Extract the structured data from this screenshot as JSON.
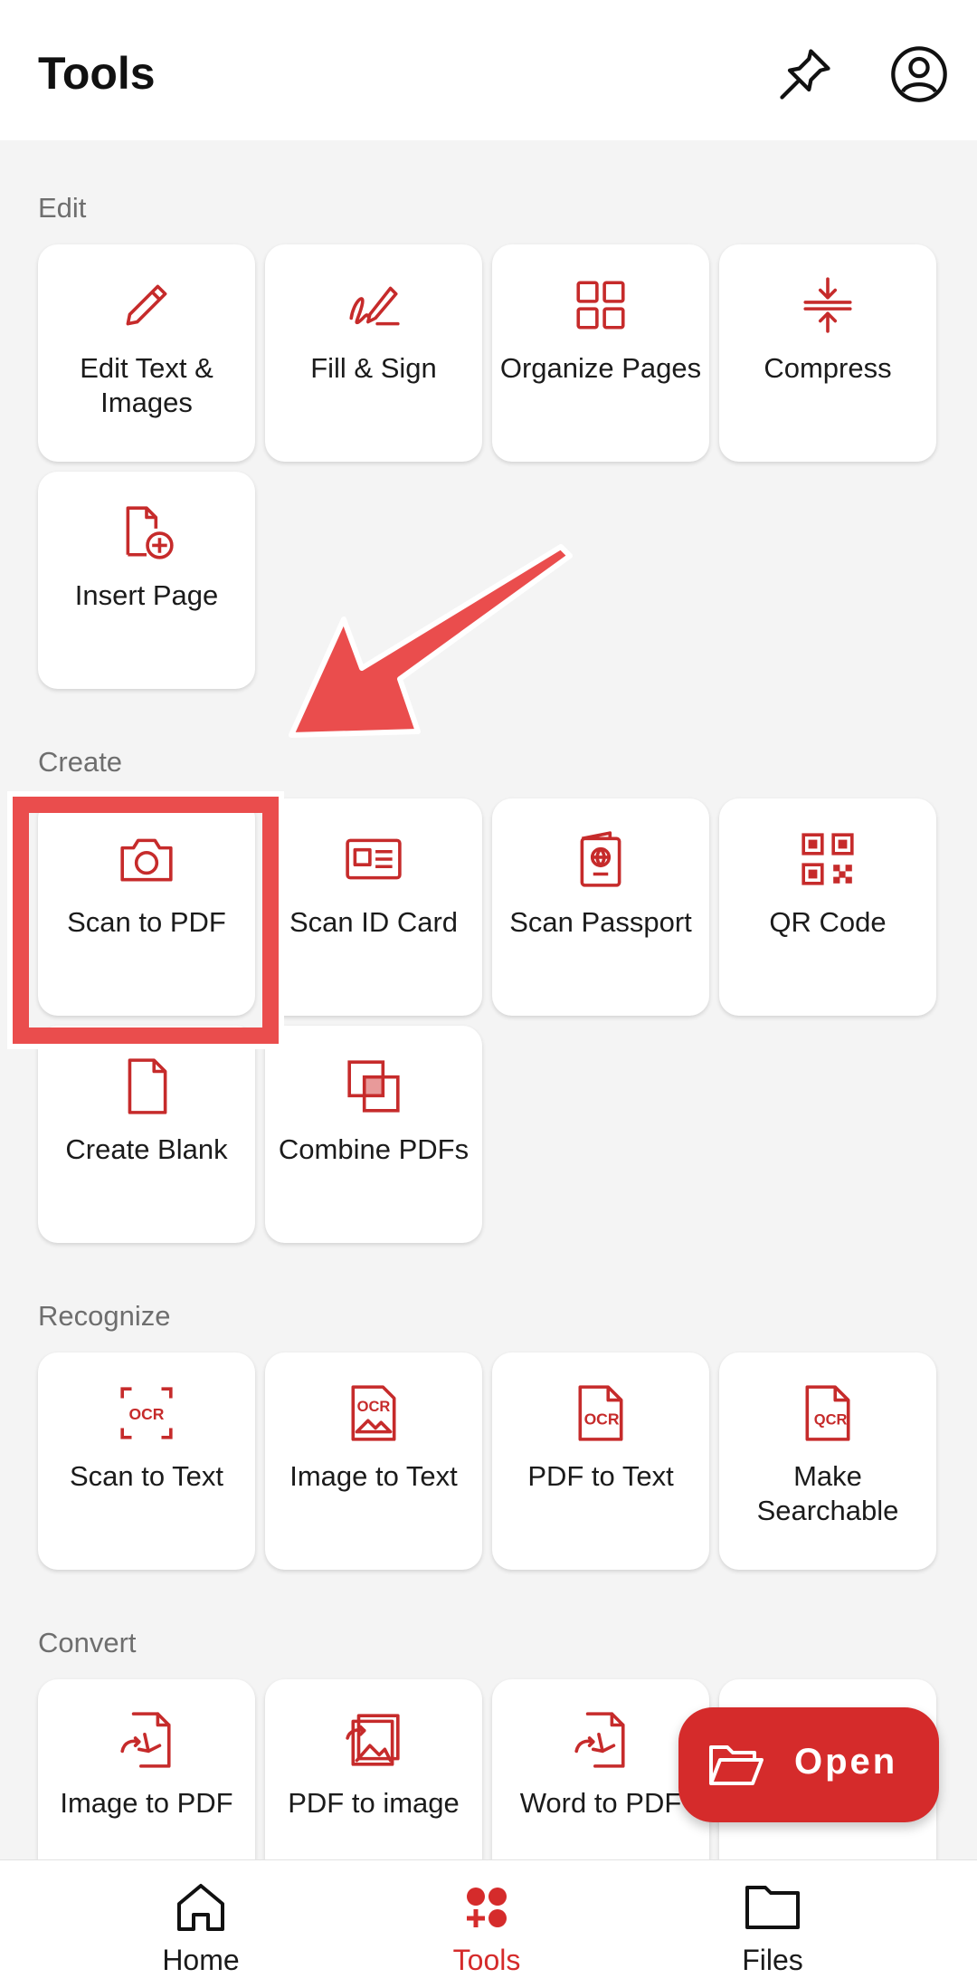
{
  "header": {
    "title": "Tools"
  },
  "sections": {
    "edit": {
      "label": "Edit",
      "items": [
        "Edit Text & Images",
        "Fill & Sign",
        "Organize Pages",
        "Compress",
        "Insert Page"
      ]
    },
    "create": {
      "label": "Create",
      "items": [
        "Scan to PDF",
        "Scan ID Card",
        "Scan Passport",
        "QR Code",
        "Create Blank",
        "Combine PDFs"
      ]
    },
    "recognize": {
      "label": "Recognize",
      "items": [
        "Scan to Text",
        "Image to Text",
        "PDF to Text",
        "Make Searchable"
      ]
    },
    "convert": {
      "label": "Convert",
      "items": [
        "Image to PDF",
        "PDF to image",
        "Word to PDF"
      ]
    }
  },
  "fab": {
    "label": "Open"
  },
  "bottom_nav": {
    "home": "Home",
    "tools": "Tools",
    "files": "Files"
  },
  "colors": {
    "accent": "#d52b2b",
    "highlight": "#ea4d4d",
    "background": "#f4f4f4"
  },
  "icons": {
    "header": [
      "pin-icon",
      "account-icon"
    ],
    "fab": "folder-open-icon",
    "nav": [
      "home-icon",
      "tools-icon",
      "folder-icon"
    ]
  }
}
